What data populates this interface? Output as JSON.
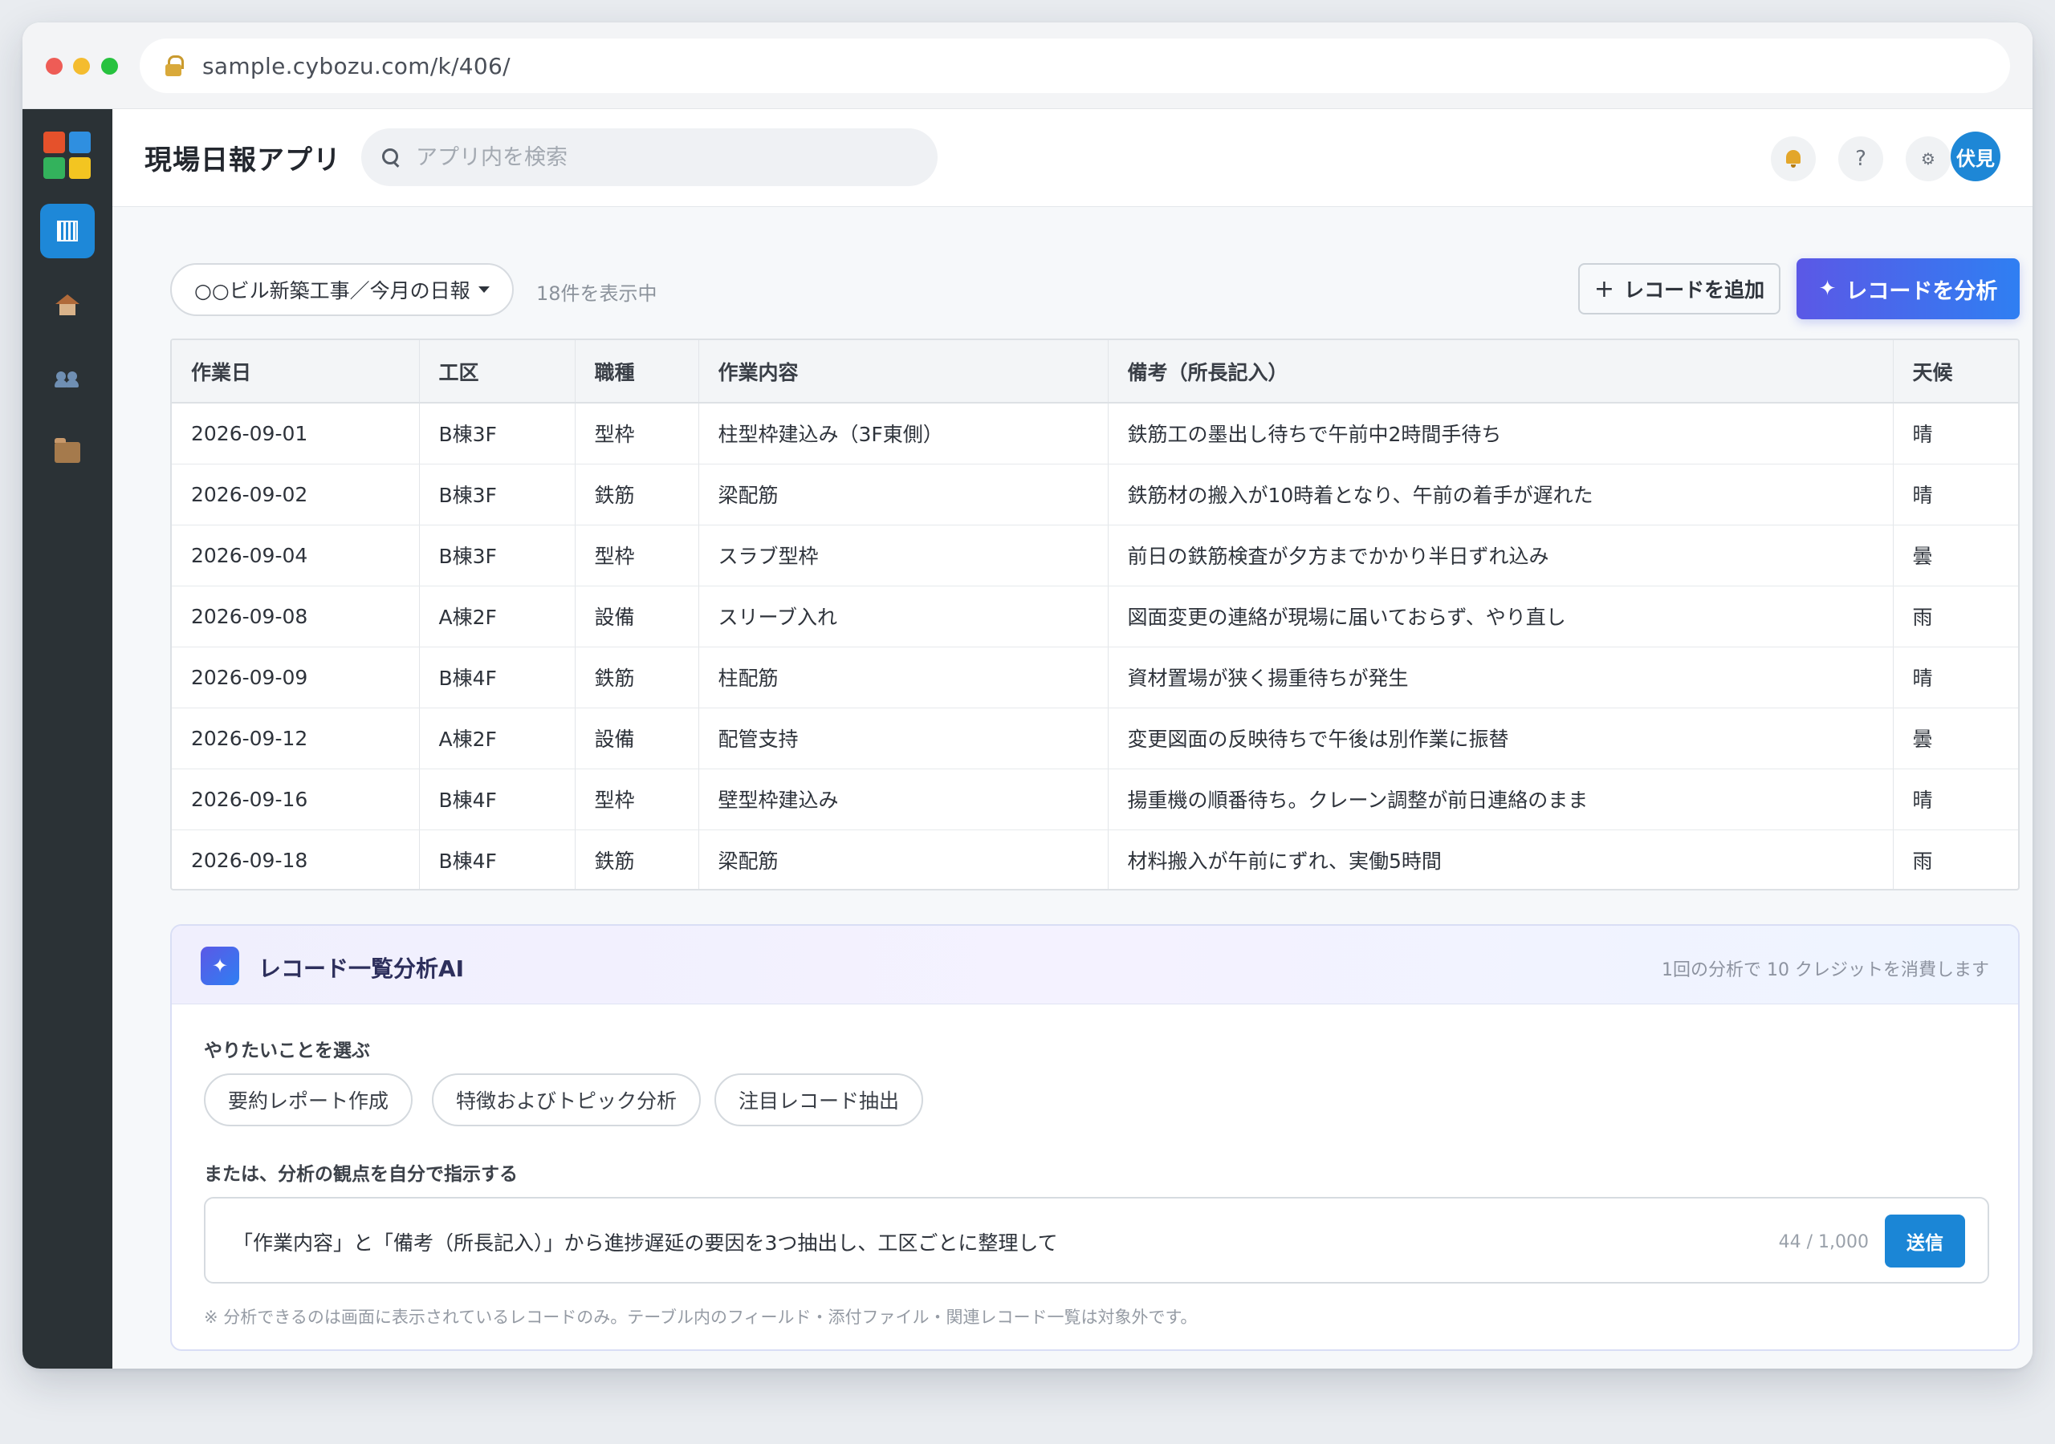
{
  "browser": {
    "url": "sample.cybozu.com/k/406/"
  },
  "sidebar": {
    "items": [
      {
        "name": "app-list",
        "icon": "grid-icon",
        "active": true
      },
      {
        "name": "space",
        "icon": "house-icon",
        "active": false
      },
      {
        "name": "people",
        "icon": "people-icon",
        "active": false
      },
      {
        "name": "apps",
        "icon": "box-icon",
        "active": false
      }
    ]
  },
  "header": {
    "title": "現場日報アプリ",
    "search_placeholder": "アプリ内を検索",
    "help_label": "?",
    "settings_label": "⚙",
    "avatar_text": "伏見"
  },
  "toolbar": {
    "view_name": "○○ビル新築工事／今月の日報",
    "record_count": "18件を表示中",
    "add_label": "レコードを追加",
    "add_plus": "+",
    "analyze_label": "レコードを分析",
    "analyze_spark": "✦"
  },
  "table": {
    "headers": [
      "作業日",
      "工区",
      "職種",
      "作業内容",
      "備考（所長記入）",
      "天候"
    ],
    "rows": [
      [
        "2026-09-01",
        "B棟3F",
        "型枠",
        "柱型枠建込み（3F東側）",
        "鉄筋工の墨出し待ちで午前中2時間手待ち",
        "晴"
      ],
      [
        "2026-09-02",
        "B棟3F",
        "鉄筋",
        "梁配筋",
        "鉄筋材の搬入が10時着となり、午前の着手が遅れた",
        "晴"
      ],
      [
        "2026-09-04",
        "B棟3F",
        "型枠",
        "スラブ型枠",
        "前日の鉄筋検査が夕方までかかり半日ずれ込み",
        "曇"
      ],
      [
        "2026-09-08",
        "A棟2F",
        "設備",
        "スリーブ入れ",
        "図面変更の連絡が現場に届いておらず、やり直し",
        "雨"
      ],
      [
        "2026-09-09",
        "B棟4F",
        "鉄筋",
        "柱配筋",
        "資材置場が狭く揚重待ちが発生",
        "晴"
      ],
      [
        "2026-09-12",
        "A棟2F",
        "設備",
        "配管支持",
        "変更図面の反映待ちで午後は別作業に振替",
        "曇"
      ],
      [
        "2026-09-16",
        "B棟4F",
        "型枠",
        "壁型枠建込み",
        "揚重機の順番待ち。クレーン調整が前日連絡のまま",
        "晴"
      ],
      [
        "2026-09-18",
        "B棟4F",
        "鉄筋",
        "梁配筋",
        "材料搬入が午前にずれ、実働5時間",
        "雨"
      ]
    ]
  },
  "ai": {
    "badge": "✦",
    "title": "レコード一覧分析AI",
    "credit_note": "1回の分析で 10 クレジットを消費します",
    "choose_label": "やりたいことを選ぶ",
    "chips": [
      "要約レポート作成",
      "特徴およびトピック分析",
      "注目レコード抽出"
    ],
    "custom_label": "または、分析の観点を自分で指示する",
    "prompt_value": "「作業内容」と「備考（所長記入）」から進捗遅延の要因を3つ抽出し、工区ごとに整理して",
    "char_count": "44 / 1,000",
    "send_label": "送信",
    "footnote": "※ 分析できるのは画面に表示されているレコードのみ。テーブル内のフィールド・添付ファイル・関連レコード一覧は対象外です。"
  },
  "colors": {
    "accent": "#1e88d8",
    "analyze_gradient_start": "#5b58e6",
    "analyze_gradient_end": "#2f7ff2",
    "sidebar_bg": "#2b3236"
  }
}
